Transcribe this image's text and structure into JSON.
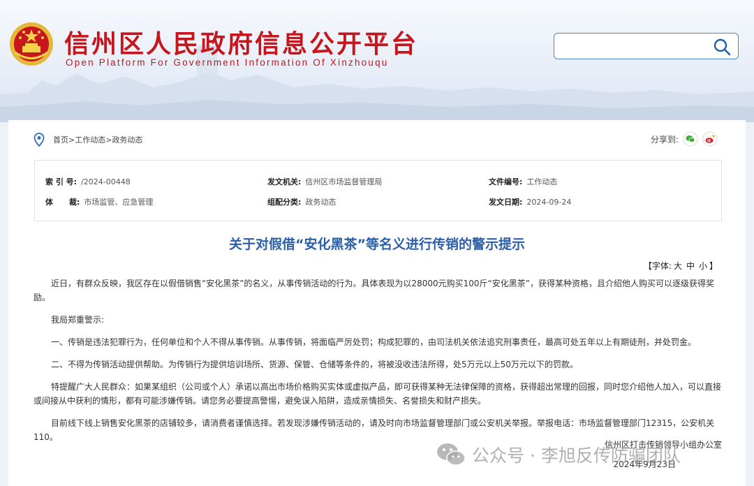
{
  "header": {
    "title": "信州区人民政府信息公开平台",
    "subtitle": "Open Platform For Government Information Of Xinzhouqu",
    "search": {
      "placeholder": "",
      "value": ""
    }
  },
  "breadcrumb": {
    "home": "首页",
    "sep": ">",
    "level1": "工作动态",
    "level2": "政务动态"
  },
  "share": {
    "label": "分享到:"
  },
  "meta": {
    "index_label": "索 引 号:",
    "index_value": "/2024-00448",
    "agency_label": "发文机关:",
    "agency_value": "信州区市场监督管理局",
    "doc_no_label": "文件编号:",
    "doc_no_value": "工作动态",
    "genre_label": "体      裁:",
    "genre_value": "市场监管、应急管理",
    "category_label": "组配分类:",
    "category_value": "政务动态",
    "date_label": "发文日期:",
    "date_value": "2024-09-24"
  },
  "article": {
    "title": "关于对假借“安化黑茶”等名义进行传销的警示提示",
    "font_label_open": "【字体:",
    "font_large": "大",
    "font_medium": "中",
    "font_small": "小",
    "font_label_close": "】",
    "paragraphs": [
      "近日，有群众反映，我区存在以假借销售“安化黑茶”的名义，从事传销活动的行为。具体表现为以28000元购买100斤“安化黑茶”，获得某种资格，且介绍他人购买可以逐级获得奖励。",
      "我局郑重警示:",
      "一、传销是违法犯罪行为，任何单位和个人不得从事传销。从事传销，将面临严厉处罚；构成犯罪的，由司法机关依法追究刑事责任，最高可处五年以上有期徒刑，并处罚金。",
      "二、不得为传销活动提供帮助。为传销行为提供培训场所、货源、保管、仓储等条件的，将被没收违法所得，处5万元以上50万元以下的罚款。",
      "特提醒广大人民群众：如果某组织（公司或个人）承诺以高出市场价格购买实体或虚拟产品，即可获得某种无法律保障的资格，获得超出常理的回报，同时您介绍他人加入，可以直接或间接从中获利的情形，都有可能涉嫌传销。请您务必要提高警惕，避免误入陷阱，造成亲情损失、名誉损失和财产损失。",
      "目前线下线上销售安化黑茶的店铺较多，请消费者谨慎选择。若发现涉嫌传销活动的，请及时向市场监督管理部门或公安机关举报。举报电话：市场监督管理部门12315，公安机关110。"
    ],
    "signature": "信州区打击传销领导小组办公室",
    "signature_date": "2024年9月23日"
  },
  "watermark": {
    "text": "公众号 · 李旭反传防骗团队"
  },
  "colors": {
    "title_red": "#c4161c",
    "title_blue": "#2b5fa8",
    "search_border": "#4a86c8"
  }
}
